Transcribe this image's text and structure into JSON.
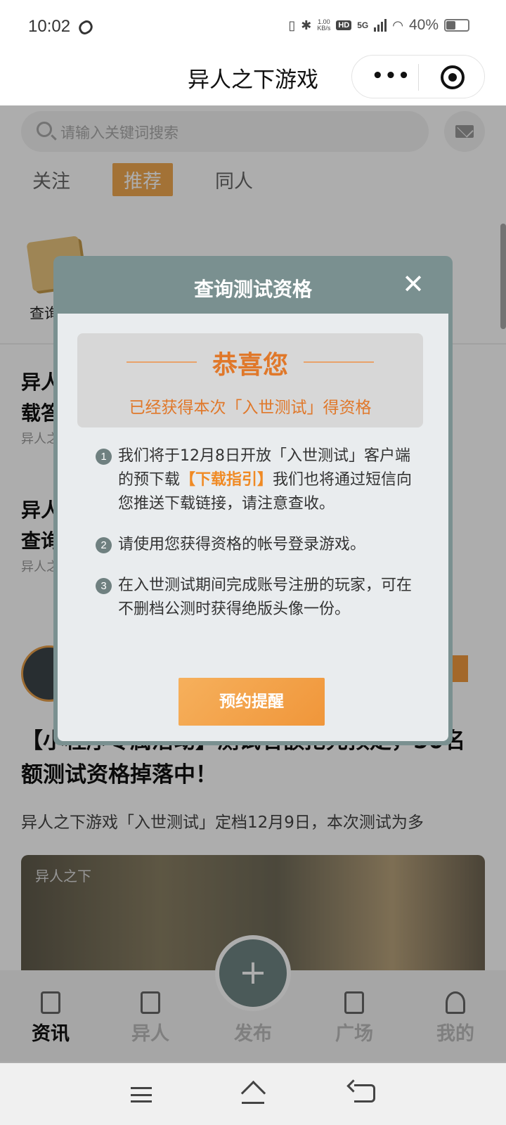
{
  "status_bar": {
    "time": "10:02",
    "net_speed_value": "1.00",
    "net_speed_unit": "KB/s",
    "hd_label": "HD",
    "network_label": "5G",
    "battery": "40%"
  },
  "header": {
    "title": "异人之下游戏",
    "more_icon": "ellipsis-icon",
    "close_icon": "target-icon"
  },
  "search": {
    "placeholder": "请输入关键词搜索"
  },
  "tabs": [
    {
      "label": "关注"
    },
    {
      "label": "推荐"
    },
    {
      "label": "同人"
    }
  ],
  "quick_entry": {
    "label": "查询"
  },
  "news": [
    {
      "title_line1": "异人",
      "title_line2": "载答",
      "meta": "异人之"
    },
    {
      "title_line1": "异人",
      "title_line2": "查询",
      "meta": "异人之"
    }
  ],
  "post": {
    "title": "【小程序专属活动】测试名额抢先预定，50名额测试资格掉落中！",
    "description": "异人之下游戏「入世测试」定档12月9日，本次测试为多",
    "image_watermark": "异人之下"
  },
  "bottom_nav": [
    {
      "label": "资讯",
      "icon": "news-icon",
      "active": true
    },
    {
      "label": "异人",
      "icon": "scroll-icon",
      "active": false
    },
    {
      "label": "发布",
      "icon": "plus-icon",
      "active": false
    },
    {
      "label": "广场",
      "icon": "chat-icon",
      "active": false
    },
    {
      "label": "我的",
      "icon": "user-icon",
      "active": false
    }
  ],
  "fab": {
    "symbol": "+"
  },
  "modal": {
    "title": "查询测试资格",
    "close_symbol": "✕",
    "congrats_title": "恭喜您",
    "congrats_subtitle": "已经获得本次「入世测试」得资格",
    "steps": [
      {
        "num": "1",
        "text_before": "我们将于12月8日开放「入世测试」客户端的预下载",
        "link": "【下载指引】",
        "text_after": "我们也将通过短信向您推送下载链接，请注意查收。"
      },
      {
        "num": "2",
        "text": "请使用您获得资格的帐号登录游戏。"
      },
      {
        "num": "3",
        "text": "在入世测试期间完成账号注册的玩家，可在不删档公测时获得绝版头像一份。"
      }
    ],
    "button_label": "预约提醒"
  },
  "colors": {
    "accent_orange": "#f0963a",
    "modal_header": "#7a9090",
    "fab": "#6f8584"
  }
}
